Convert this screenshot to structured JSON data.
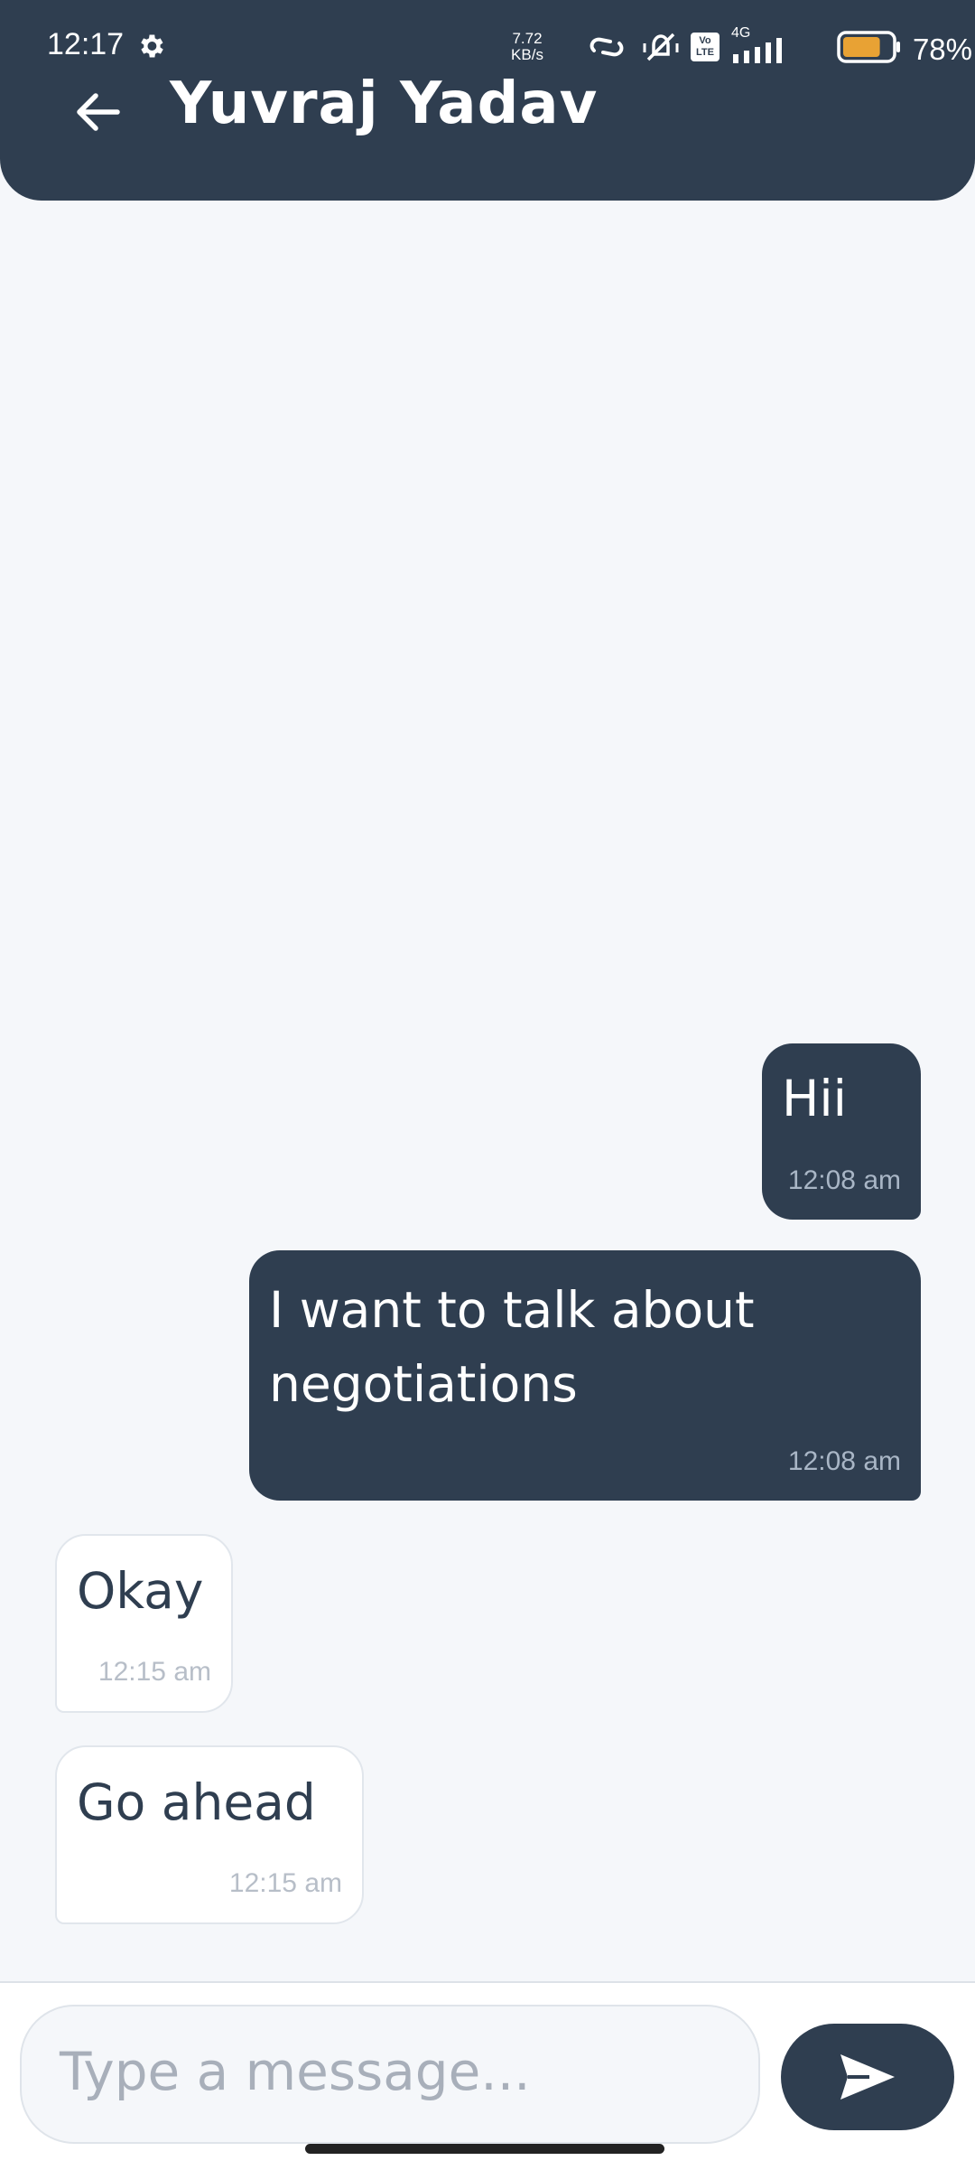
{
  "status_bar": {
    "time": "12:17",
    "net_speed_value": "7.72",
    "net_speed_unit": "KB/s",
    "network_type": "4G",
    "volte_label": "Vo LTE",
    "battery_level": 0.78,
    "battery_percent": "78%",
    "icons": [
      "settings-gear",
      "link",
      "vibrate-silent",
      "volte",
      "signal",
      "battery"
    ]
  },
  "header": {
    "title": "Yuvraj Yadav",
    "back_icon": "arrow-left"
  },
  "messages": [
    {
      "direction": "outgoing",
      "text": "Hii",
      "time": "12:08 am"
    },
    {
      "direction": "outgoing",
      "text": [
        "I want to talk about",
        "negotiations"
      ],
      "time": "12:08 am"
    },
    {
      "direction": "incoming",
      "text": "Okay",
      "time": "12:15 am"
    },
    {
      "direction": "incoming",
      "text": "Go ahead",
      "time": "12:15 am"
    }
  ],
  "composer": {
    "placeholder": "Type a message...",
    "send_icon": "send-arrow"
  },
  "colors": {
    "primary": "#2f3e50",
    "background": "#f5f7fa",
    "incoming_bubble": "#ffffff",
    "battery_fill": "#e8a234"
  }
}
